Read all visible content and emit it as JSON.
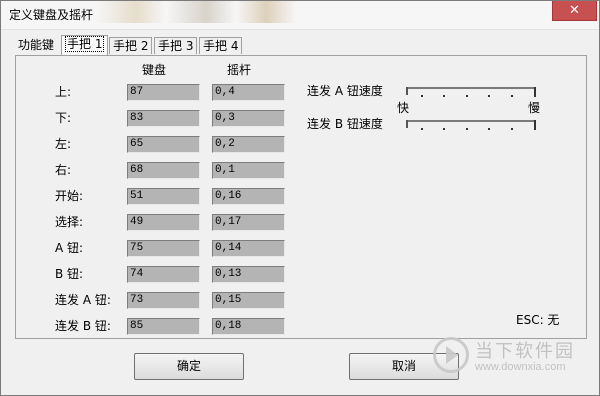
{
  "window": {
    "title": "定义键盘及摇杆",
    "close_label": "✕"
  },
  "tabs": [
    {
      "label": "功能键",
      "active": false
    },
    {
      "label": "手把 1",
      "active": true
    },
    {
      "label": "手把 2",
      "active": false
    },
    {
      "label": "手把 3",
      "active": false
    },
    {
      "label": "手把 4",
      "active": false
    }
  ],
  "columns": {
    "keyboard": "键盘",
    "joystick": "摇杆"
  },
  "rows": [
    {
      "label": "上:",
      "key": "87",
      "joy": "0,4"
    },
    {
      "label": "下:",
      "key": "83",
      "joy": "0,3"
    },
    {
      "label": "左:",
      "key": "65",
      "joy": "0,2"
    },
    {
      "label": "右:",
      "key": "68",
      "joy": "0,1"
    },
    {
      "label": "开始:",
      "key": "51",
      "joy": "0,16"
    },
    {
      "label": "选择:",
      "key": "49",
      "joy": "0,17"
    },
    {
      "label": "A 钮:",
      "key": "75",
      "joy": "0,14"
    },
    {
      "label": "B 钮:",
      "key": "74",
      "joy": "0,13"
    },
    {
      "label": "连发 A 钮:",
      "key": "73",
      "joy": "0,15"
    },
    {
      "label": "连发 B 钮:",
      "key": "85",
      "joy": "0,18"
    }
  ],
  "turbo": {
    "a_label": "连发 A 钮速度",
    "b_label": "连发 B 钮速度",
    "fast_label": "快",
    "slow_label": "慢",
    "a_level": 0.0,
    "b_level": 0.0
  },
  "esc_text": "ESC: 无",
  "buttons": {
    "ok": "确定",
    "cancel": "取消"
  },
  "watermark": {
    "name": "当下软件园",
    "url": "www.downxia.com"
  }
}
